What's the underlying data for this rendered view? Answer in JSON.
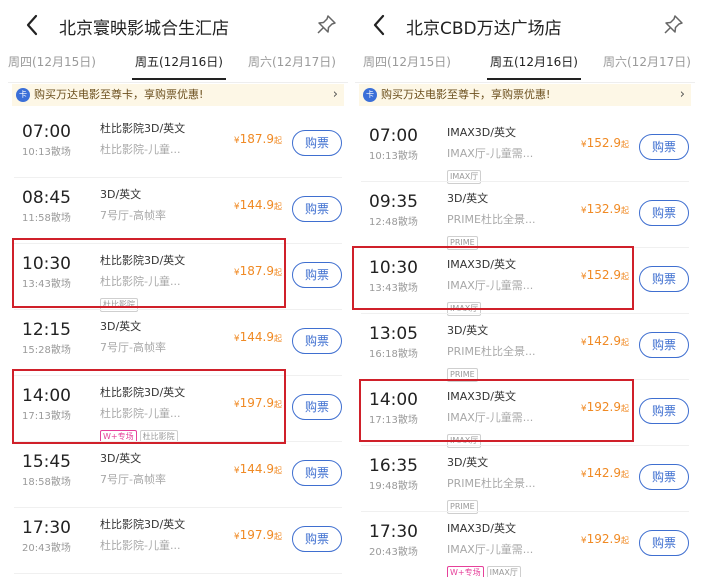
{
  "icons": {
    "back": "chevron-left-icon",
    "pin": "pin-icon",
    "promo": "card-icon",
    "promo_chevron": "chevron-right-icon"
  },
  "colors": {
    "accent": "#3f6fd0",
    "price": "#f08a24",
    "highlight": "#d0202a",
    "promo_bg": "#fdf7e6",
    "wplus": "#e6409a"
  },
  "panels": [
    {
      "title": "北京寰映影城合生汇店",
      "tabs": [
        {
          "label": "周四(12月15日)",
          "active": false
        },
        {
          "label": "周五(12月16日)",
          "active": true
        },
        {
          "label": "周六(12月17日)",
          "active": false
        }
      ],
      "promo": {
        "icon": "卡",
        "text": "购买万达电影至尊卡，享购票优惠!",
        "chevron": "›"
      },
      "showtimes": [
        {
          "start": "07:00",
          "end": "10:13散场",
          "format": "杜比影院3D/英文",
          "hall": "杜比影院-儿童...",
          "tags": [],
          "currency": "¥",
          "price": "187.9",
          "unit": "起",
          "button": "购票"
        },
        {
          "start": "08:45",
          "end": "11:58散场",
          "format": "3D/英文",
          "hall": "7号厅-高帧率",
          "tags": [],
          "currency": "¥",
          "price": "144.9",
          "unit": "起",
          "button": "购票"
        },
        {
          "start": "10:30",
          "end": "13:43散场",
          "format": "杜比影院3D/英文",
          "hall": "杜比影院-儿童...",
          "tags": [
            "杜比影院"
          ],
          "currency": "¥",
          "price": "187.9",
          "unit": "起",
          "button": "购票"
        },
        {
          "start": "12:15",
          "end": "15:28散场",
          "format": "3D/英文",
          "hall": "7号厅-高帧率",
          "tags": [],
          "currency": "¥",
          "price": "144.9",
          "unit": "起",
          "button": "购票"
        },
        {
          "start": "14:00",
          "end": "17:13散场",
          "format": "杜比影院3D/英文",
          "hall": "杜比影院-儿童...",
          "tags": [
            "W+专场",
            "杜比影院"
          ],
          "currency": "¥",
          "price": "197.9",
          "unit": "起",
          "button": "购票"
        },
        {
          "start": "15:45",
          "end": "18:58散场",
          "format": "3D/英文",
          "hall": "7号厅-高帧率",
          "tags": [],
          "currency": "¥",
          "price": "144.9",
          "unit": "起",
          "button": "购票"
        },
        {
          "start": "17:30",
          "end": "20:43散场",
          "format": "杜比影院3D/英文",
          "hall": "杜比影院-儿童...",
          "tags": [],
          "currency": "¥",
          "price": "197.9",
          "unit": "起",
          "button": "购票"
        }
      ]
    },
    {
      "title": "北京CBD万达广场店",
      "tabs": [
        {
          "label": "周四(12月15日)",
          "active": false
        },
        {
          "label": "周五(12月16日)",
          "active": true
        },
        {
          "label": "周六(12月17日)",
          "active": false
        }
      ],
      "promo": {
        "icon": "卡",
        "text": "购买万达电影至尊卡，享购票优惠!",
        "chevron": "›"
      },
      "showtimes": [
        {
          "start": "07:00",
          "end": "10:13散场",
          "format": "IMAX3D/英文",
          "hall": "IMAX厅-儿童需...",
          "tags": [
            "IMAX厅"
          ],
          "currency": "¥",
          "price": "152.9",
          "unit": "起",
          "button": "购票"
        },
        {
          "start": "09:35",
          "end": "12:48散场",
          "format": "3D/英文",
          "hall": "PRIME杜比全景...",
          "tags": [
            "PRIME"
          ],
          "currency": "¥",
          "price": "132.9",
          "unit": "起",
          "button": "购票"
        },
        {
          "start": "10:30",
          "end": "13:43散场",
          "format": "IMAX3D/英文",
          "hall": "IMAX厅-儿童需...",
          "tags": [
            "IMAX厅"
          ],
          "currency": "¥",
          "price": "152.9",
          "unit": "起",
          "button": "购票"
        },
        {
          "start": "13:05",
          "end": "16:18散场",
          "format": "3D/英文",
          "hall": "PRIME杜比全景...",
          "tags": [
            "PRIME"
          ],
          "currency": "¥",
          "price": "142.9",
          "unit": "起",
          "button": "购票"
        },
        {
          "start": "14:00",
          "end": "17:13散场",
          "format": "IMAX3D/英文",
          "hall": "IMAX厅-儿童需...",
          "tags": [
            "IMAX厅"
          ],
          "currency": "¥",
          "price": "192.9",
          "unit": "起",
          "button": "购票"
        },
        {
          "start": "16:35",
          "end": "19:48散场",
          "format": "3D/英文",
          "hall": "PRIME杜比全景...",
          "tags": [
            "PRIME"
          ],
          "currency": "¥",
          "price": "142.9",
          "unit": "起",
          "button": "购票"
        },
        {
          "start": "17:30",
          "end": "20:43散场",
          "format": "IMAX3D/英文",
          "hall": "IMAX厅-儿童需...",
          "tags": [
            "W+专场",
            "IMAX厅"
          ],
          "currency": "¥",
          "price": "192.9",
          "unit": "起",
          "button": "购票"
        }
      ]
    }
  ]
}
